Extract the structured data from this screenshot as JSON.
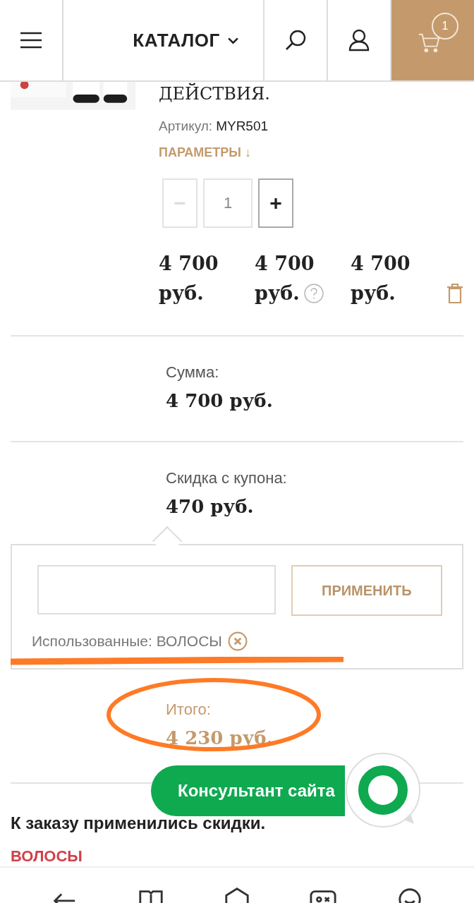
{
  "header": {
    "catalog_label": "КАТАЛОГ",
    "cart_count": "1"
  },
  "product": {
    "title": "ДЕЙСТВИЯ.",
    "article_label": "Артикул:",
    "article": "MYR501",
    "params_link": "ПАРАМЕТРЫ ↓",
    "quantity": "1",
    "minus": {
      "label": "−",
      "disabled": true
    },
    "plus": {
      "label": "+",
      "disabled": false
    },
    "prices": [
      {
        "amount": "4 700",
        "unit": "руб.",
        "info": false
      },
      {
        "amount": "4 700",
        "unit": "руб.",
        "info": true
      },
      {
        "amount": "4 700",
        "unit": "руб.",
        "info": false
      }
    ]
  },
  "summary": [
    {
      "label": "Сумма:",
      "value": "4 700 руб."
    },
    {
      "label": "Скидка с купона:",
      "value": "470 руб."
    }
  ],
  "coupon": {
    "button": "ПРИМЕНИТЬ",
    "used": "Использованные: ВОЛОСЫ"
  },
  "total": {
    "label": "Итого:",
    "value": "4 230 руб."
  },
  "discounts": {
    "title": "К заказу применились скидки.",
    "items": [
      "ВОЛОСЫ"
    ]
  },
  "consultant": {
    "label": "Консультант сайта"
  }
}
